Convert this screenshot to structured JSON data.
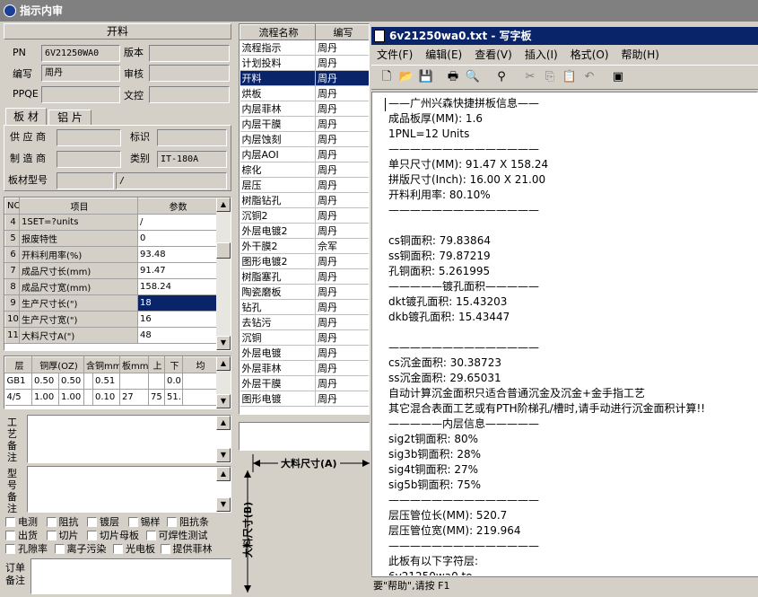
{
  "window": {
    "title": "指示内审"
  },
  "cutting": {
    "header": "开料",
    "fields": [
      {
        "label": "PN",
        "value": "6V21250WA0"
      },
      {
        "label": "版本",
        "value": ""
      },
      {
        "label": "编写",
        "value": "周丹"
      },
      {
        "label": "审核",
        "value": ""
      },
      {
        "label": "PPQE",
        "value": ""
      },
      {
        "label": "文控",
        "value": ""
      }
    ]
  },
  "tabs": [
    {
      "label": "板 材"
    },
    {
      "label": "铝 片"
    }
  ],
  "material": {
    "supplier_label": "供 应 商",
    "supplier": "",
    "mark_label": "标识",
    "mark": "",
    "maker_label": "制 造 商",
    "maker": "",
    "category_label": "类别",
    "category": "IT-180A",
    "model_label": "板材型号",
    "model": "",
    "model2": "/"
  },
  "param_table": {
    "headers": [
      "NO",
      "项目",
      "参数"
    ],
    "rows": [
      {
        "no": "4",
        "item": "1SET=?units",
        "value": "/"
      },
      {
        "no": "5",
        "item": "报废特性",
        "value": "0"
      },
      {
        "no": "6",
        "item": "开料利用率(%)",
        "value": "93.48"
      },
      {
        "no": "7",
        "item": "成品尺寸长(mm)",
        "value": "91.47"
      },
      {
        "no": "8",
        "item": "成品尺寸宽(mm)",
        "value": "158.24"
      },
      {
        "no": "9",
        "item": "生产尺寸长(\")",
        "value": "18"
      },
      {
        "no": "10",
        "item": "生产尺寸宽(\")",
        "value": "16"
      },
      {
        "no": "11",
        "item": "大料尺寸A(\")",
        "value": "48"
      }
    ]
  },
  "layer_table": {
    "headers": [
      "层",
      "铜厚(OZ)",
      "含铜mm",
      "板mm",
      "上",
      "下",
      "均"
    ],
    "rows": [
      [
        "GB1",
        "0.50",
        "0.50",
        "",
        "0.51",
        "",
        "",
        "0.0"
      ],
      [
        "4/5",
        "1.00",
        "1.00",
        "",
        "0.10",
        "27",
        "75",
        "51."
      ]
    ]
  },
  "notes": {
    "process_note": "工艺备注",
    "model_note": "型号备注",
    "order_note": "订单备注"
  },
  "checkboxes": [
    "电测",
    "阻抗",
    "镀层",
    "锡样",
    "阻抗条",
    "出货",
    "切片",
    "切片母板",
    "可焊性测试",
    "孔隙率",
    "离子污染",
    "光电板",
    "提供菲林"
  ],
  "process_list": {
    "headers": [
      "流程名称",
      "编写"
    ],
    "rows": [
      [
        "流程指示",
        "周丹"
      ],
      [
        "计划投料",
        "周丹"
      ],
      [
        "开料",
        "周丹"
      ],
      [
        "烘板",
        "周丹"
      ],
      [
        "内层菲林",
        "周丹"
      ],
      [
        "内层干膜",
        "周丹"
      ],
      [
        "内层蚀刻",
        "周丹"
      ],
      [
        "内层AOI",
        "周丹"
      ],
      [
        "棕化",
        "周丹"
      ],
      [
        "层压",
        "周丹"
      ],
      [
        "树脂钻孔",
        "周丹"
      ],
      [
        "沉铜2",
        "周丹"
      ],
      [
        "外层电镀2",
        "周丹"
      ],
      [
        "外干膜2",
        "佘军"
      ],
      [
        "图形电镀2",
        "周丹"
      ],
      [
        "树脂塞孔",
        "周丹"
      ],
      [
        "陶瓷磨板",
        "周丹"
      ],
      [
        "钻孔",
        "周丹"
      ],
      [
        "去钻污",
        "周丹"
      ],
      [
        "沉铜",
        "周丹"
      ],
      [
        "外层电镀",
        "周丹"
      ],
      [
        "外层菲林",
        "周丹"
      ],
      [
        "外层干膜",
        "周丹"
      ],
      [
        "图形电镀",
        "周丹"
      ]
    ],
    "selected_index": 2
  },
  "diagram": {
    "a_label": "大料尺寸(A)",
    "b_label": "大料尺寸(B)"
  },
  "wordpad": {
    "title": "6v21250wa0.txt - 写字板",
    "menu": [
      "文件(F)",
      "编辑(E)",
      "查看(V)",
      "插入(I)",
      "格式(O)",
      "帮助(H)"
    ],
    "lines": [
      "——广州兴森快捷拼板信息——",
      "成品板厚(MM): 1.6",
      "1PNL=12 Units",
      "——————————————",
      "单只尺寸(MM): 91.47 X 158.24",
      "拼版尺寸(Inch): 16.00 X 21.00",
      "开料利用率: 80.10%",
      "——————————————",
      "",
      "cs铜面积: 79.83864",
      "ss铜面积: 79.87219",
      "孔铜面积: 5.261995",
      "—————镀孔面积—————",
      "dkt镀孔面积: 15.43203",
      "dkb镀孔面积: 15.43447",
      "",
      "——————————————",
      "cs沉金面积: 30.38723",
      "ss沉金面积: 29.65031",
      "自动计算沉金面积只适合普通沉金及沉金+金手指工艺",
      "其它混合表面工艺或有PTH阶梯孔/槽时,请手动进行沉金面积计算!!",
      "—————内层信息—————",
      "sig2t铜面积: 80%",
      "sig3b铜面积: 28%",
      "sig4t铜面积: 27%",
      "sig5b铜面积: 75%",
      "——————————————",
      "层压管位长(MM): 520.7",
      "层压管位宽(MM): 219.964",
      "——————————————",
      "此板有以下字符层:",
      "6v21250wa0.to",
      "6v21250wa0.bo"
    ],
    "status": "要\"帮助\",请按 F1"
  }
}
